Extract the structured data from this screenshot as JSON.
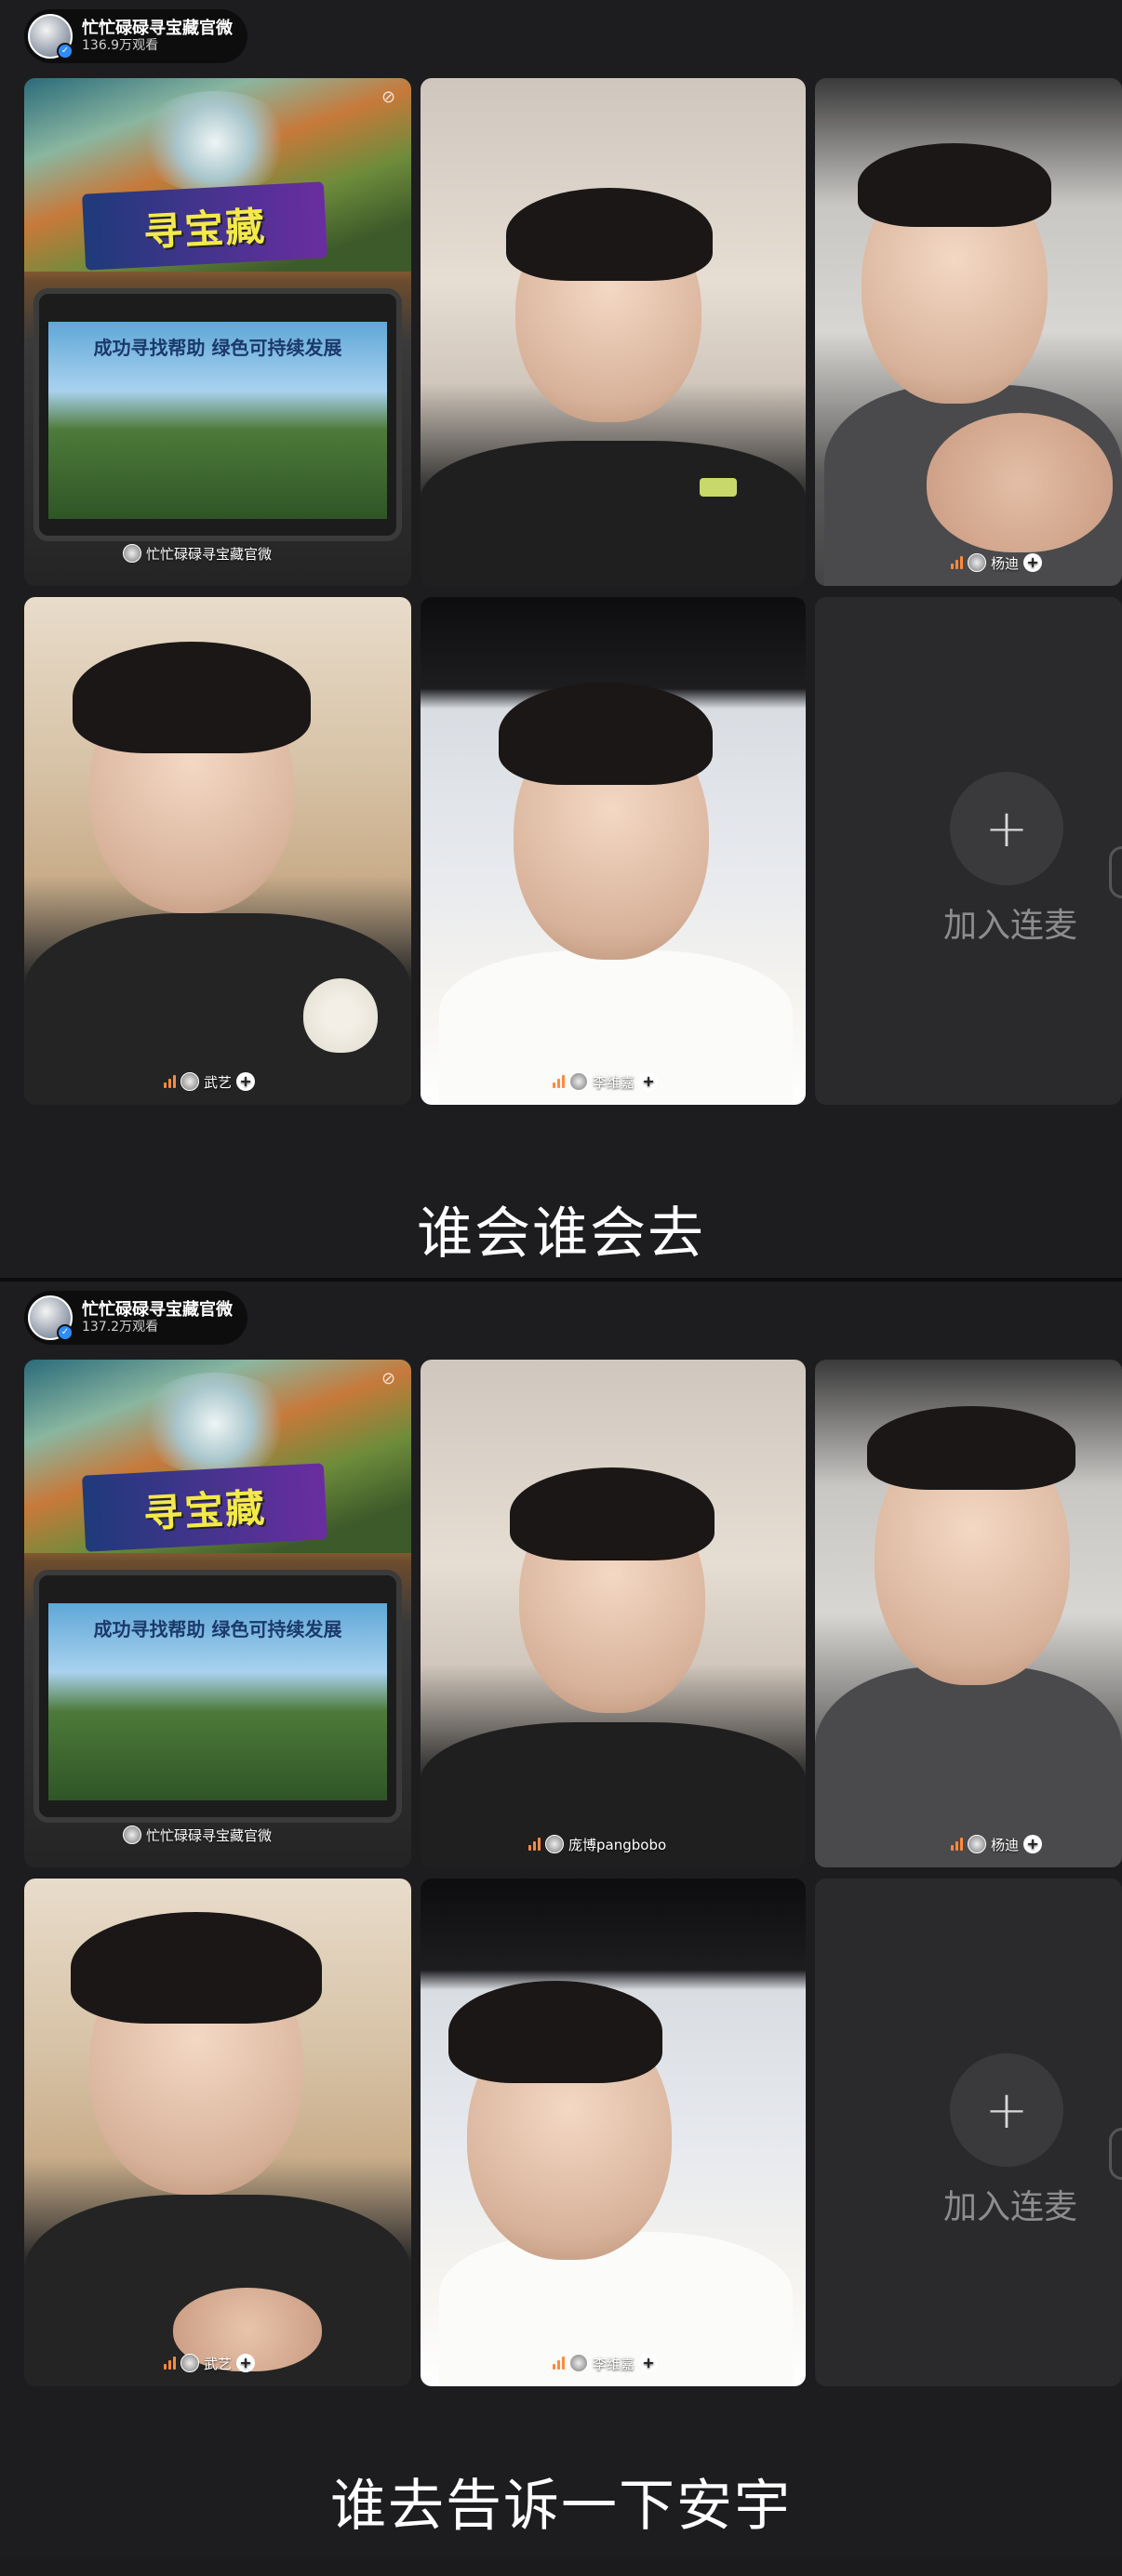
{
  "panels": [
    {
      "host": {
        "name": "忙忙碌碌寻宝藏官微",
        "views": "136.9万观看"
      },
      "banner_logo": "寻宝藏",
      "tablet_text": "成功寻找帮助 绿色可持续发展",
      "tiles": {
        "t1_label": "忙忙碌碌寻宝藏官微",
        "t3_label": "杨迪",
        "t4_label": "武艺",
        "t5_label": "李维嘉"
      },
      "join": {
        "icon": "+",
        "text": "加入连麦"
      },
      "caption": "谁会谁会去"
    },
    {
      "host": {
        "name": "忙忙碌碌寻宝藏官微",
        "views": "137.2万观看"
      },
      "banner_logo": "寻宝藏",
      "tablet_text": "成功寻找帮助 绿色可持续发展",
      "tiles": {
        "t1_label": "忙忙碌碌寻宝藏官微",
        "t2_label": "庞博pangbobo",
        "t3_label": "杨迪",
        "t4_label": "武艺",
        "t5_label": "李维嘉"
      },
      "join": {
        "icon": "+",
        "text": "加入连麦"
      },
      "caption": "谁去告诉一下安宇"
    }
  ],
  "colors": {
    "background": "#1d1d20",
    "audio_bars": "#ff8a3c",
    "join_button": "#3a3a3c",
    "join_text": "#8d8d8f"
  },
  "icons": [
    "verified-badge-icon",
    "audio-level-icon",
    "follow-plus-icon",
    "mic-off-icon",
    "plus-icon"
  ]
}
